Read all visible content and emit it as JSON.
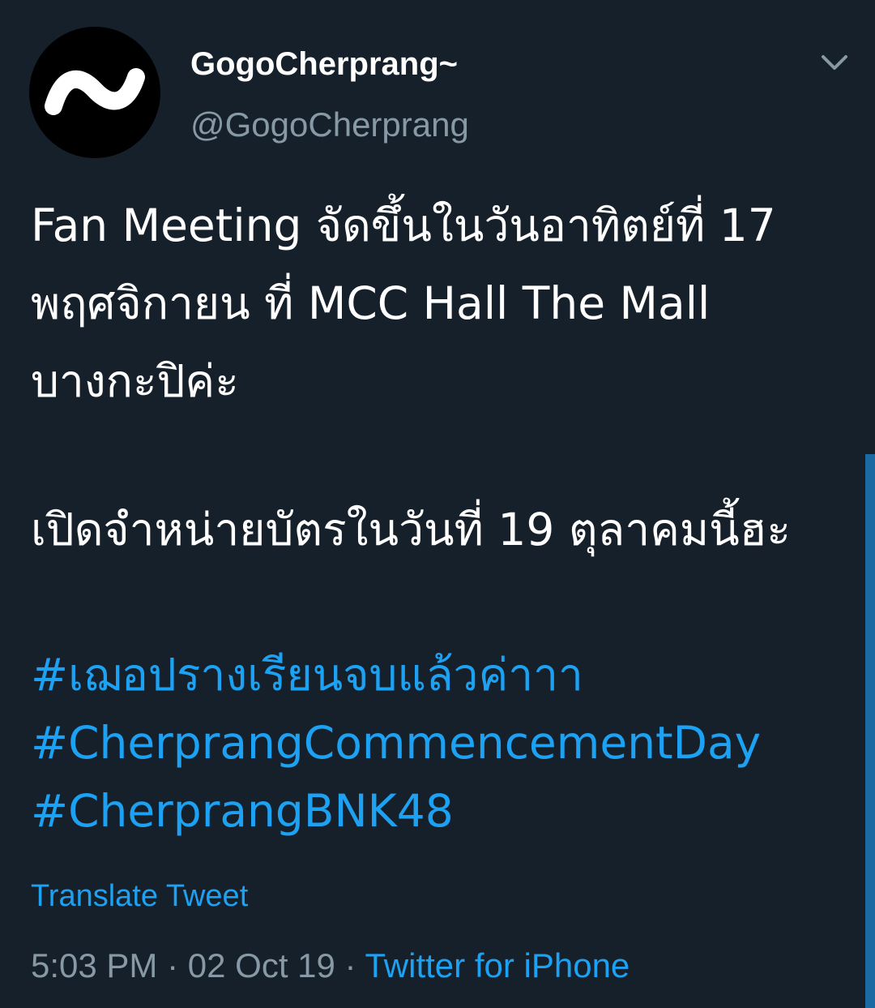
{
  "tweet": {
    "display_name": "GogoCherprang~",
    "handle": "@GogoCherprang",
    "avatar_icon": "tilde-logo",
    "body_lines": [
      "Fan Meeting จัดขึ้นในวันอาทิตย์ที่ 17",
      "พฤศจิกายน ที่ MCC Hall The Mall",
      "บางกะปิค่ะ",
      "เปิดจำหน่ายบัตรในวันที่ 19 ตุลาคมนี้ฮะ"
    ],
    "hashtags": [
      "#เฌอปรางเรียนจบแล้วค่าาา",
      "#CherprangCommencementDay",
      "#CherprangBNK48"
    ],
    "translate_label": "Translate Tweet",
    "time": "5:03 PM",
    "separator": "·",
    "date": "02 Oct 19",
    "source": "Twitter for iPhone"
  },
  "colors": {
    "background": "#15202b",
    "text": "#ffffff",
    "muted": "#8899a6",
    "accent": "#1da1f2"
  }
}
